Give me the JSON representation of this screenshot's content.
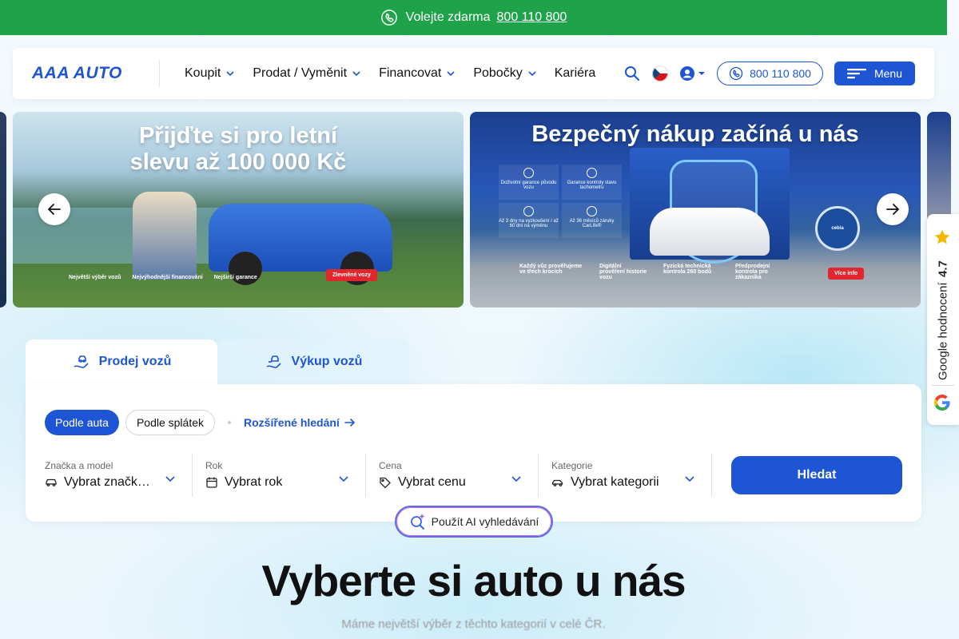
{
  "topbar": {
    "text": "Volejte zdarma",
    "phone": "800 110 800",
    "icon": "phone-icon"
  },
  "header": {
    "logo": "AAA AUTO",
    "nav": [
      {
        "label": "Koupit",
        "has_dropdown": true
      },
      {
        "label": "Prodat / Vyměnit",
        "has_dropdown": true
      },
      {
        "label": "Financovat",
        "has_dropdown": true
      },
      {
        "label": "Pobočky",
        "has_dropdown": true
      },
      {
        "label": "Kariéra",
        "has_dropdown": false
      }
    ],
    "phone_button": "800 110 800",
    "menu_button": "Menu",
    "language": "CZ"
  },
  "carousel": {
    "slides": [
      {
        "title_line1": "Přijďte si pro letní",
        "title_line2": "slevu až 100 000 Kč",
        "bullets": [
          "Největší výběr vozů",
          "Nejvýhodnější financování",
          "Nejširší garance"
        ],
        "cta": "Zlevněné vozy"
      },
      {
        "title": "Bezpečný nákup začíná u nás",
        "features": [
          "Doživotní garance původu vozu",
          "Garance kontroly stavu tachometru",
          "Až 3 dny na vyzkoušení / až 60 dní na výměnu",
          "Až 36 měsíců záruky CarLife®"
        ],
        "steps": [
          "Každý vůz prověřujeme ve třech krocích",
          "Digitální prověření historie vozu",
          "Fyzická technická kontrola 260 bodů",
          "Předprodejní kontrola pro zákazníka"
        ],
        "badge": "CERTIFIKOVANÝ",
        "badge_brand": "cebia",
        "cta": "Více info"
      }
    ]
  },
  "google_badge": {
    "label": "Google hodnocení",
    "rating": "4.7"
  },
  "tabs": [
    {
      "label": "Prodej vozů",
      "active": true
    },
    {
      "label": "Výkup vozů",
      "active": false
    }
  ],
  "search": {
    "modes": [
      {
        "label": "Podle auta",
        "active": true
      },
      {
        "label": "Podle splátek",
        "active": false
      }
    ],
    "advanced_link": "Rozšířené hledání",
    "filters": [
      {
        "label": "Značka a model",
        "value": "Vybrat značku a model",
        "icon": "car-icon"
      },
      {
        "label": "Rok",
        "value": "Vybrat rok",
        "icon": "calendar-icon"
      },
      {
        "label": "Cena",
        "value": "Vybrat cenu",
        "icon": "tag-icon"
      },
      {
        "label": "Kategorie",
        "value": "Vybrat kategorii",
        "icon": "car-category-icon"
      }
    ],
    "submit": "Hledat",
    "ai_button": "Použít AI vyhledávání"
  },
  "section": {
    "title": "Vyberte si auto u nás",
    "subtitle": "Máme největší výběr z těchto kategorií v celé ČR."
  },
  "colors": {
    "brand_blue": "#1e55d4",
    "topbar_green": "#1fa34a",
    "cta_red": "#e1262d"
  }
}
